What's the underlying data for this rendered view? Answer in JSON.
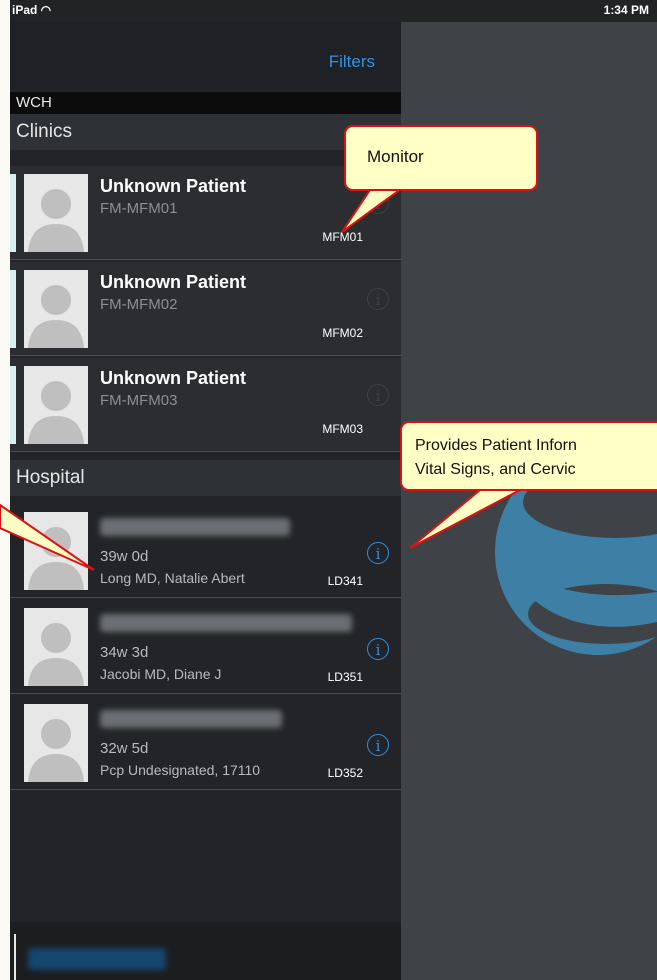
{
  "status_bar": {
    "carrier": "iPad ◠",
    "time": "1:34 PM"
  },
  "nav": {
    "filters_label": "Filters"
  },
  "org_label": "WCH",
  "sections": {
    "clinics": {
      "title": "Clinics",
      "rows": [
        {
          "name": "Unknown Patient",
          "subtitle": "FM-MFM01",
          "code": "MFM01"
        },
        {
          "name": "Unknown Patient",
          "subtitle": "FM-MFM02",
          "code": "MFM02"
        },
        {
          "name": "Unknown Patient",
          "subtitle": "FM-MFM03",
          "code": "MFM03"
        }
      ]
    },
    "hospital": {
      "title": "Hospital",
      "rows": [
        {
          "gestation": "39w 0d",
          "provider": "Long MD, Natalie Abert",
          "code": "LD341"
        },
        {
          "gestation": "34w 3d",
          "provider": "Jacobi MD, Diane J",
          "code": "LD351"
        },
        {
          "gestation": "32w 5d",
          "provider": "Pcp Undesignated, 17110",
          "code": "LD352"
        }
      ]
    }
  },
  "icons": {
    "info": "info-circle-icon",
    "avatar": "person-silhouette-icon",
    "logo": "app-logo-icon",
    "wifi": "wifi-icon"
  },
  "callouts": {
    "monitor": "Monitor",
    "patient_info_line1": "Provides Patient Inforn",
    "patient_info_line2": "Vital Signs, and Cervic"
  },
  "colors": {
    "accent": "#2f93e6",
    "callout_fill": "#ffffc6",
    "callout_border": "#e01010",
    "logo": "#3e7fa6"
  }
}
